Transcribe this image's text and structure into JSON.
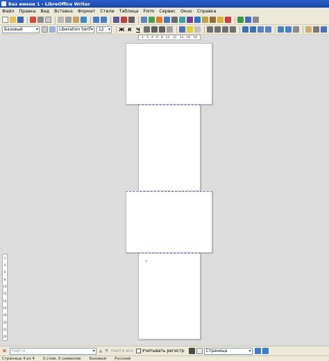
{
  "window": {
    "title": "Без имени 1 - LibreOffice Writer"
  },
  "menu": [
    "Файл",
    "Правка",
    "Вид",
    "Вставка",
    "Формат",
    "Стили",
    "Таблица",
    "Form",
    "Сервис",
    "Окно",
    "Справка"
  ],
  "formatting": {
    "paragraph_style": "Базовый",
    "font_name": "Liberation Serif",
    "font_size": "12",
    "bold_label": "Ж",
    "italic_label": "К",
    "underline_label": "Ч"
  },
  "ruler": {
    "ticks": [
      "1",
      "2",
      "4",
      "6",
      "8",
      "10",
      "12",
      "14",
      "16",
      "18"
    ]
  },
  "vertical_ruler": {
    "ticks": [
      "2",
      "4",
      "6",
      "8",
      "10",
      "12",
      "14",
      "16",
      "18",
      "20",
      "22",
      "24"
    ]
  },
  "find_bar": {
    "placeholder": "Найти",
    "find_all": "Найти все",
    "match_case": "Учитывать регистр",
    "scope": "Страница"
  },
  "status": {
    "page": "Страница 4 из 4",
    "words": "0 слов, 0 символов",
    "style": "Базовый",
    "language": "Русский"
  },
  "colors": {
    "titlebar": "#1a48a8",
    "chrome": "#ece9d8",
    "workspace": "#dcdcdc",
    "page_boundary": "#7070d0"
  }
}
